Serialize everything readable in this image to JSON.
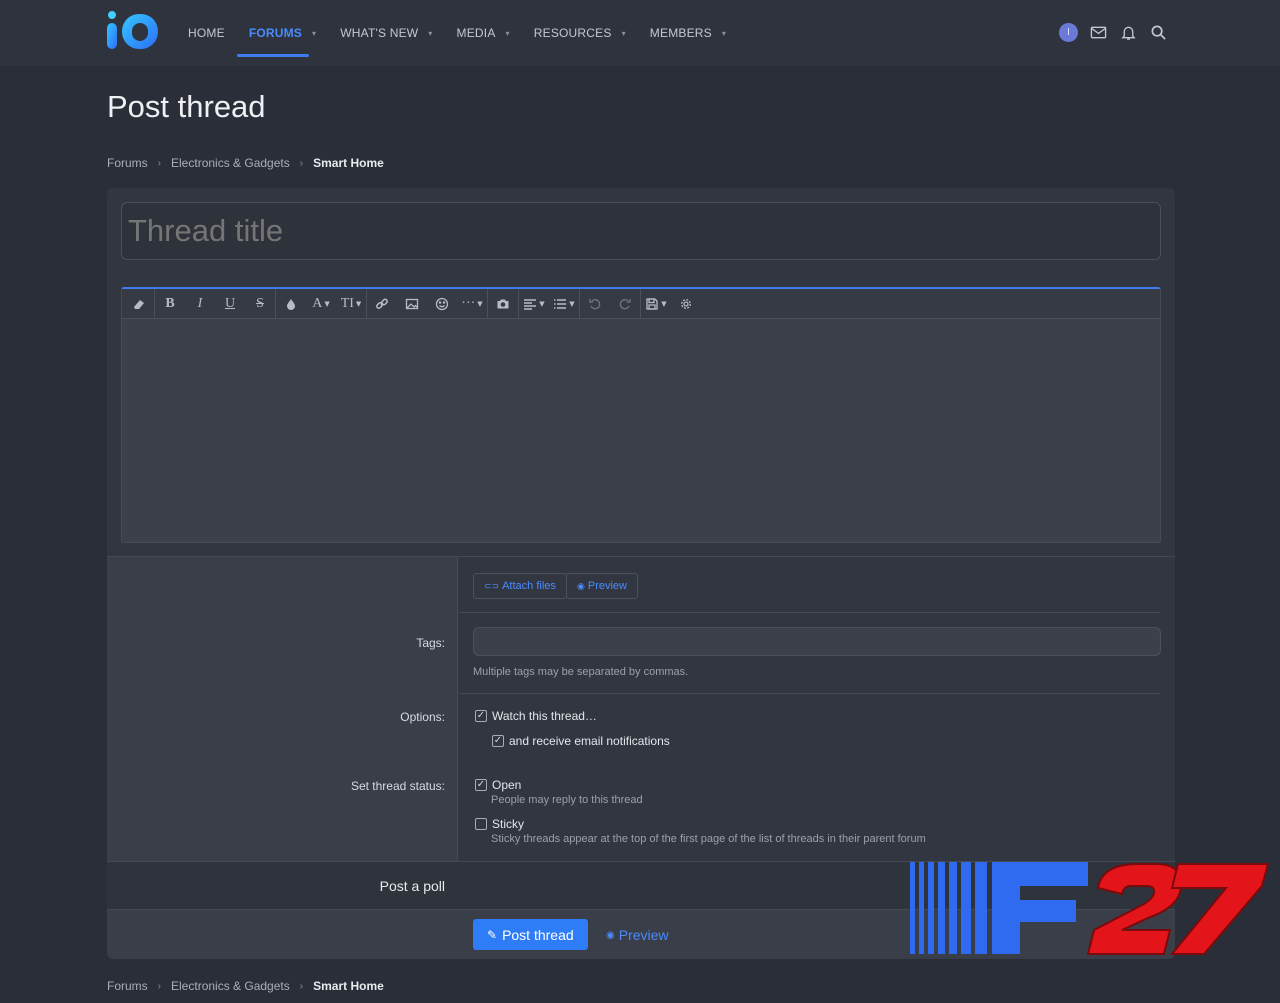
{
  "nav": {
    "logo_text": "iO",
    "items": [
      {
        "label": "HOME",
        "dropdown": false
      },
      {
        "label": "FORUMS",
        "dropdown": true,
        "active": true
      },
      {
        "label": "WHAT'S NEW",
        "dropdown": true
      },
      {
        "label": "MEDIA",
        "dropdown": true
      },
      {
        "label": "RESOURCES",
        "dropdown": true
      },
      {
        "label": "MEMBERS",
        "dropdown": true
      }
    ],
    "avatar_letter": "I",
    "icons": [
      "mail-icon",
      "bell-icon",
      "search-icon"
    ]
  },
  "page": {
    "title": "Post thread"
  },
  "breadcrumb": {
    "items": [
      "Forums",
      "Electronics & Gadgets",
      "Smart Home"
    ],
    "separator": "›"
  },
  "form": {
    "title_placeholder": "Thread title",
    "toolbar": [
      "eraser-icon",
      "bold-icon",
      "italic-icon",
      "underline-icon",
      "strikethrough-icon",
      "color-icon",
      "font-family-icon",
      "font-size-icon",
      "link-icon",
      "image-icon",
      "emoji-icon",
      "more-icon",
      "camera-icon",
      "align-icon",
      "list-icon",
      "undo-icon",
      "redo-icon",
      "drafts-icon",
      "settings-icon"
    ],
    "attach_label": "Attach files",
    "preview_label": "Preview",
    "tags_label": "Tags:",
    "tags_hint": "Multiple tags may be separated by commas.",
    "options_label": "Options:",
    "watch_label": "Watch this thread…",
    "watch_checked": true,
    "email_label": "and receive email notifications",
    "email_checked": true,
    "status_label": "Set thread status:",
    "open_label": "Open",
    "open_checked": true,
    "open_hint": "People may reply to this thread",
    "sticky_label": "Sticky",
    "sticky_checked": false,
    "sticky_hint": "Sticky threads appear at the top of the first page of the list of threads in their parent forum",
    "poll_label": "Post a poll",
    "submit_label": "Post thread",
    "submit_preview_label": "Preview"
  },
  "watermark": {
    "text": "F27"
  },
  "colors": {
    "accent": "#2f7df6",
    "link": "#4a8cff",
    "background": "#2a2e38",
    "watermark_blue": "#2f6bf0",
    "watermark_red": "#e3151b"
  }
}
